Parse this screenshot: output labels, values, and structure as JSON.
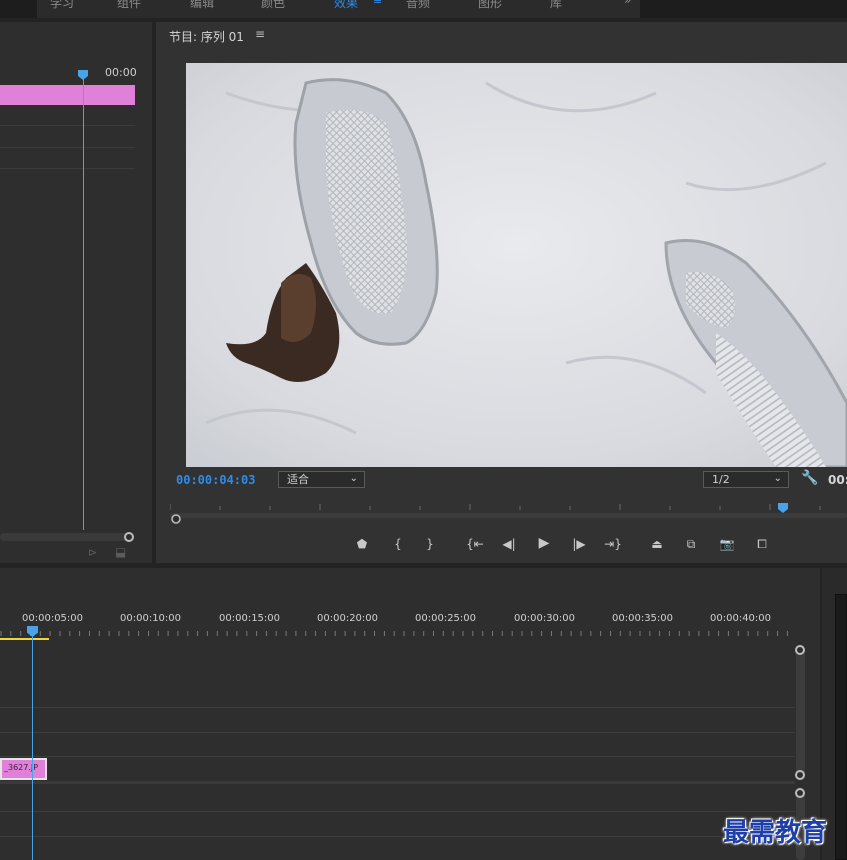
{
  "top_tabs": [
    "学习",
    "组件",
    "编辑",
    "颜色",
    "效果",
    "音频",
    "图形",
    "库"
  ],
  "active_tab_index": 4,
  "source_monitor": {
    "timecode": "00:00"
  },
  "program_monitor": {
    "title": "节目: 序列 01",
    "menu_icon": "hamburger-menu-icon",
    "timecode": "00:00:04:03",
    "fit_dropdown": "适合",
    "resolution_dropdown": "1/2",
    "timecode_right": "00:",
    "controls": [
      "marker-icon",
      "mark-in-icon",
      "mark-out-icon",
      "go-to-in-icon",
      "step-back-icon",
      "play-icon",
      "step-forward-icon",
      "go-to-out-icon",
      "lift-icon",
      "extract-icon",
      "export-frame-icon",
      "compare-icon"
    ]
  },
  "timeline": {
    "ruler_labels": [
      "00:00:05:00",
      "00:00:10:00",
      "00:00:15:00",
      "00:00:20:00",
      "00:00:25:00",
      "00:00:30:00",
      "00:00:35:00",
      "00:00:40:00"
    ],
    "clip_label": "_3627.JP"
  },
  "watermark": "最需教育",
  "colors": {
    "accent_blue": "#2d8ceb",
    "clip_pink": "#e080d8",
    "playhead": "#4aa3e8",
    "work_area": "#e8d83a"
  }
}
